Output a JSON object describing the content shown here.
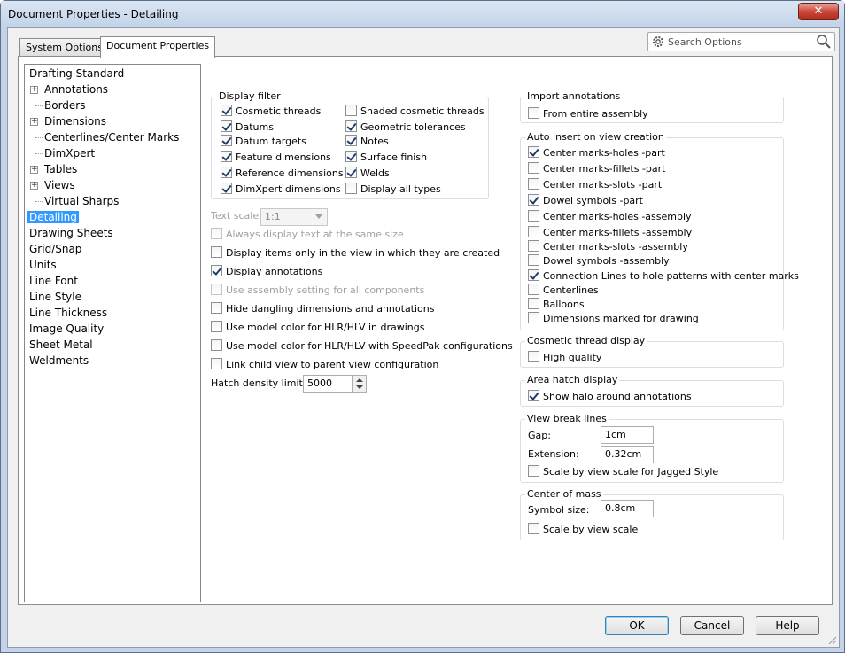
{
  "window": {
    "title": "Document Properties - Detailing",
    "close_label": "✕"
  },
  "tabs": [
    {
      "label": "System Options",
      "active": false
    },
    {
      "label": "Document Properties",
      "active": true
    }
  ],
  "search": {
    "placeholder": "Search Options"
  },
  "tree": [
    {
      "label": "Drafting Standard",
      "level": 0,
      "expander": false
    },
    {
      "label": "Annotations",
      "level": 1,
      "expander": true
    },
    {
      "label": "Borders",
      "level": 1,
      "expander": false
    },
    {
      "label": "Dimensions",
      "level": 1,
      "expander": true
    },
    {
      "label": "Centerlines/Center Marks",
      "level": 1,
      "expander": false
    },
    {
      "label": "DimXpert",
      "level": 1,
      "expander": false
    },
    {
      "label": "Tables",
      "level": 1,
      "expander": true
    },
    {
      "label": "Views",
      "level": 1,
      "expander": true
    },
    {
      "label": "Virtual Sharps",
      "level": 1,
      "expander": false
    },
    {
      "label": "Detailing",
      "level": 0,
      "selected": true
    },
    {
      "label": "Drawing Sheets",
      "level": 0
    },
    {
      "label": "Grid/Snap",
      "level": 0
    },
    {
      "label": "Units",
      "level": 0
    },
    {
      "label": "Line Font",
      "level": 0
    },
    {
      "label": "Line Style",
      "level": 0
    },
    {
      "label": "Line Thickness",
      "level": 0
    },
    {
      "label": "Image Quality",
      "level": 0
    },
    {
      "label": "Sheet Metal",
      "level": 0
    },
    {
      "label": "Weldments",
      "level": 0
    }
  ],
  "display_filter": {
    "title": "Display filter",
    "left": [
      {
        "label": "Cosmetic threads",
        "checked": true
      },
      {
        "label": "Datums",
        "checked": true
      },
      {
        "label": "Datum targets",
        "checked": true
      },
      {
        "label": "Feature dimensions",
        "checked": true
      },
      {
        "label": "Reference dimensions",
        "checked": true
      },
      {
        "label": "DimXpert dimensions",
        "checked": true
      }
    ],
    "right": [
      {
        "label": "Shaded cosmetic threads",
        "checked": false
      },
      {
        "label": "Geometric tolerances",
        "checked": true
      },
      {
        "label": "Notes",
        "checked": true
      },
      {
        "label": "Surface finish",
        "checked": true
      },
      {
        "label": "Welds",
        "checked": true
      },
      {
        "label": "Display all types",
        "checked": false
      }
    ]
  },
  "text_scale": {
    "label": "Text scale:",
    "value": "1:1"
  },
  "mid_options": [
    {
      "label": "Always display text at the same size",
      "checked": false,
      "disabled": true
    },
    {
      "label": "Display items only in the view in which they are created",
      "checked": false
    },
    {
      "label": "Display annotations",
      "checked": true
    },
    {
      "label": "Use assembly setting for all components",
      "checked": false,
      "disabled": true
    },
    {
      "label": "Hide dangling dimensions and annotations",
      "checked": false
    },
    {
      "label": "Use model color for HLR/HLV in drawings",
      "checked": false
    },
    {
      "label": "Use model color for HLR/HLV with SpeedPak configurations",
      "checked": false
    },
    {
      "label": "Link child view to parent view configuration",
      "checked": false
    }
  ],
  "hatch": {
    "label": "Hatch density limit:",
    "value": "5000"
  },
  "import_annotations": {
    "title": "Import annotations",
    "items": [
      {
        "label": "From entire assembly",
        "checked": false
      }
    ]
  },
  "auto_insert": {
    "title": "Auto insert on view creation",
    "items": [
      {
        "label": "Center marks-holes -part",
        "checked": true
      },
      {
        "label": "Center marks-fillets -part",
        "checked": false
      },
      {
        "label": "Center marks-slots  -part",
        "checked": false
      },
      {
        "label": "Dowel symbols -part",
        "checked": true
      },
      {
        "label": "Center marks-holes -assembly",
        "checked": false
      },
      {
        "label": "Center marks-fillets -assembly",
        "checked": false
      },
      {
        "label": "Center marks-slots  -assembly",
        "checked": false
      },
      {
        "label": "Dowel symbols -assembly",
        "checked": false
      },
      {
        "label": "Connection Lines to hole patterns with center marks",
        "checked": true
      },
      {
        "label": "Centerlines",
        "checked": false
      },
      {
        "label": "Balloons",
        "checked": false
      },
      {
        "label": "Dimensions marked for drawing",
        "checked": false
      }
    ]
  },
  "cosmetic_thread": {
    "title": "Cosmetic thread display",
    "items": [
      {
        "label": "High quality",
        "checked": false
      }
    ]
  },
  "area_hatch": {
    "title": "Area hatch display",
    "items": [
      {
        "label": "Show halo around annotations",
        "checked": true
      }
    ]
  },
  "view_break": {
    "title": "View break lines",
    "gap_label": "Gap:",
    "gap_value": "1cm",
    "ext_label": "Extension:",
    "ext_value": "0.32cm",
    "scale_label": "Scale by view scale for Jagged Style",
    "scale_checked": false
  },
  "center_of_mass": {
    "title": "Center of mass",
    "size_label": "Symbol size:",
    "size_value": "0.8cm",
    "scale_label": "Scale by view scale",
    "scale_checked": false
  },
  "buttons": {
    "ok": "OK",
    "cancel": "Cancel",
    "help": "Help"
  }
}
